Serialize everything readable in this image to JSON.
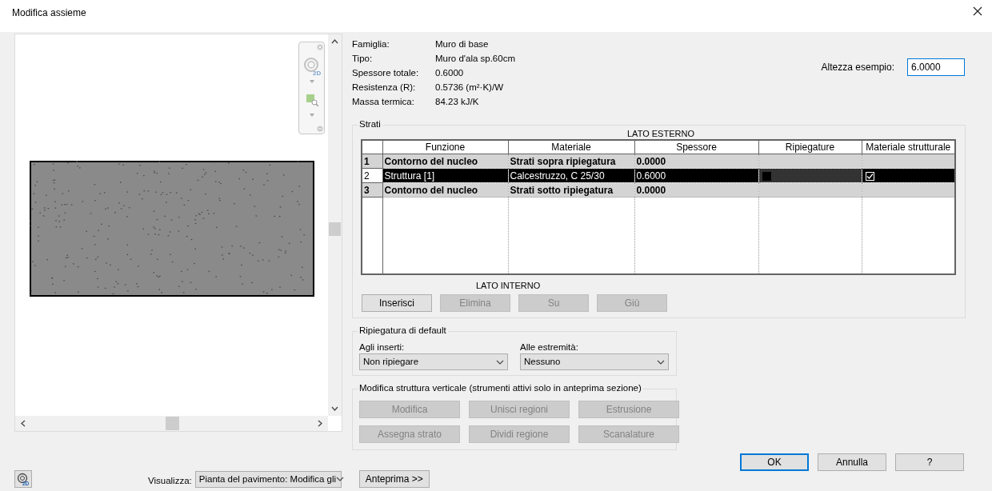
{
  "window": {
    "title": "Modifica assieme"
  },
  "properties": [
    {
      "label": "Famiglia:",
      "value": "Muro di base"
    },
    {
      "label": "Tipo:",
      "value": "Muro d'ala sp.60cm"
    },
    {
      "label": "Spessore totale:",
      "value": "0.6000"
    },
    {
      "label": "Resistenza (R):",
      "value": "0.5736 (m²·K)/W"
    },
    {
      "label": "Massa termica:",
      "value": "84.23 kJ/K"
    }
  ],
  "navigation_bar": {
    "wheel_label": "2D"
  },
  "sample_height": {
    "label": "Altezza esempio:",
    "value": "6.0000"
  },
  "layers": {
    "title": "Strati",
    "top_label": "LATO ESTERNO",
    "bottom_label": "LATO INTERNO",
    "columns": [
      "Funzione",
      "Materiale",
      "Spessore",
      "Ripiegature",
      "Materiale strutturale"
    ],
    "rows": [
      {
        "number": "1",
        "function": "Contorno del nucleo",
        "material": "Strati sopra ripiegatura",
        "thickness": "0.0000",
        "kind": "boundary",
        "selected": false
      },
      {
        "number": "2",
        "function": "Struttura [1]",
        "material": "Calcestruzzo, C 25/30",
        "thickness": "0.6000",
        "kind": "layer",
        "selected": true,
        "wraps": false,
        "structural_material": true
      },
      {
        "number": "3",
        "function": "Contorno del nucleo",
        "material": "Strati sotto ripiegatura",
        "thickness": "0.0000",
        "kind": "boundary",
        "selected": false
      }
    ],
    "buttons": [
      {
        "label": "Inserisci",
        "disabled": false
      },
      {
        "label": "Elimina",
        "disabled": true
      },
      {
        "label": "Su",
        "disabled": true
      },
      {
        "label": "Giù",
        "disabled": true
      }
    ]
  },
  "default_wrapping": {
    "title": "Ripiegatura di default",
    "fields": [
      {
        "label": "Agli inserti:",
        "value": "Non ripiegare"
      },
      {
        "label": "Alle estremità:",
        "value": "Nessuno"
      }
    ]
  },
  "vertical_structure": {
    "title": "Modifica struttura verticale (strumenti attivi solo in anteprima sezione)",
    "buttons": [
      {
        "label": "Modifica",
        "disabled": true
      },
      {
        "label": "Unisci regioni",
        "disabled": true
      },
      {
        "label": "Estrusione",
        "disabled": true
      },
      {
        "label": "Assegna strato",
        "disabled": true
      },
      {
        "label": "Dividi regione",
        "disabled": true
      },
      {
        "label": "Scanalature",
        "disabled": true
      }
    ]
  },
  "dialog_buttons": [
    {
      "label": "OK",
      "default": true
    },
    {
      "label": "Annulla",
      "default": false
    },
    {
      "label": "?",
      "default": false
    }
  ],
  "view": {
    "wheel_label": "2D",
    "label": "Visualizza:",
    "value": "Pianta del pavimento: Modifica gli"
  },
  "preview_button": "Anteprima >>"
}
